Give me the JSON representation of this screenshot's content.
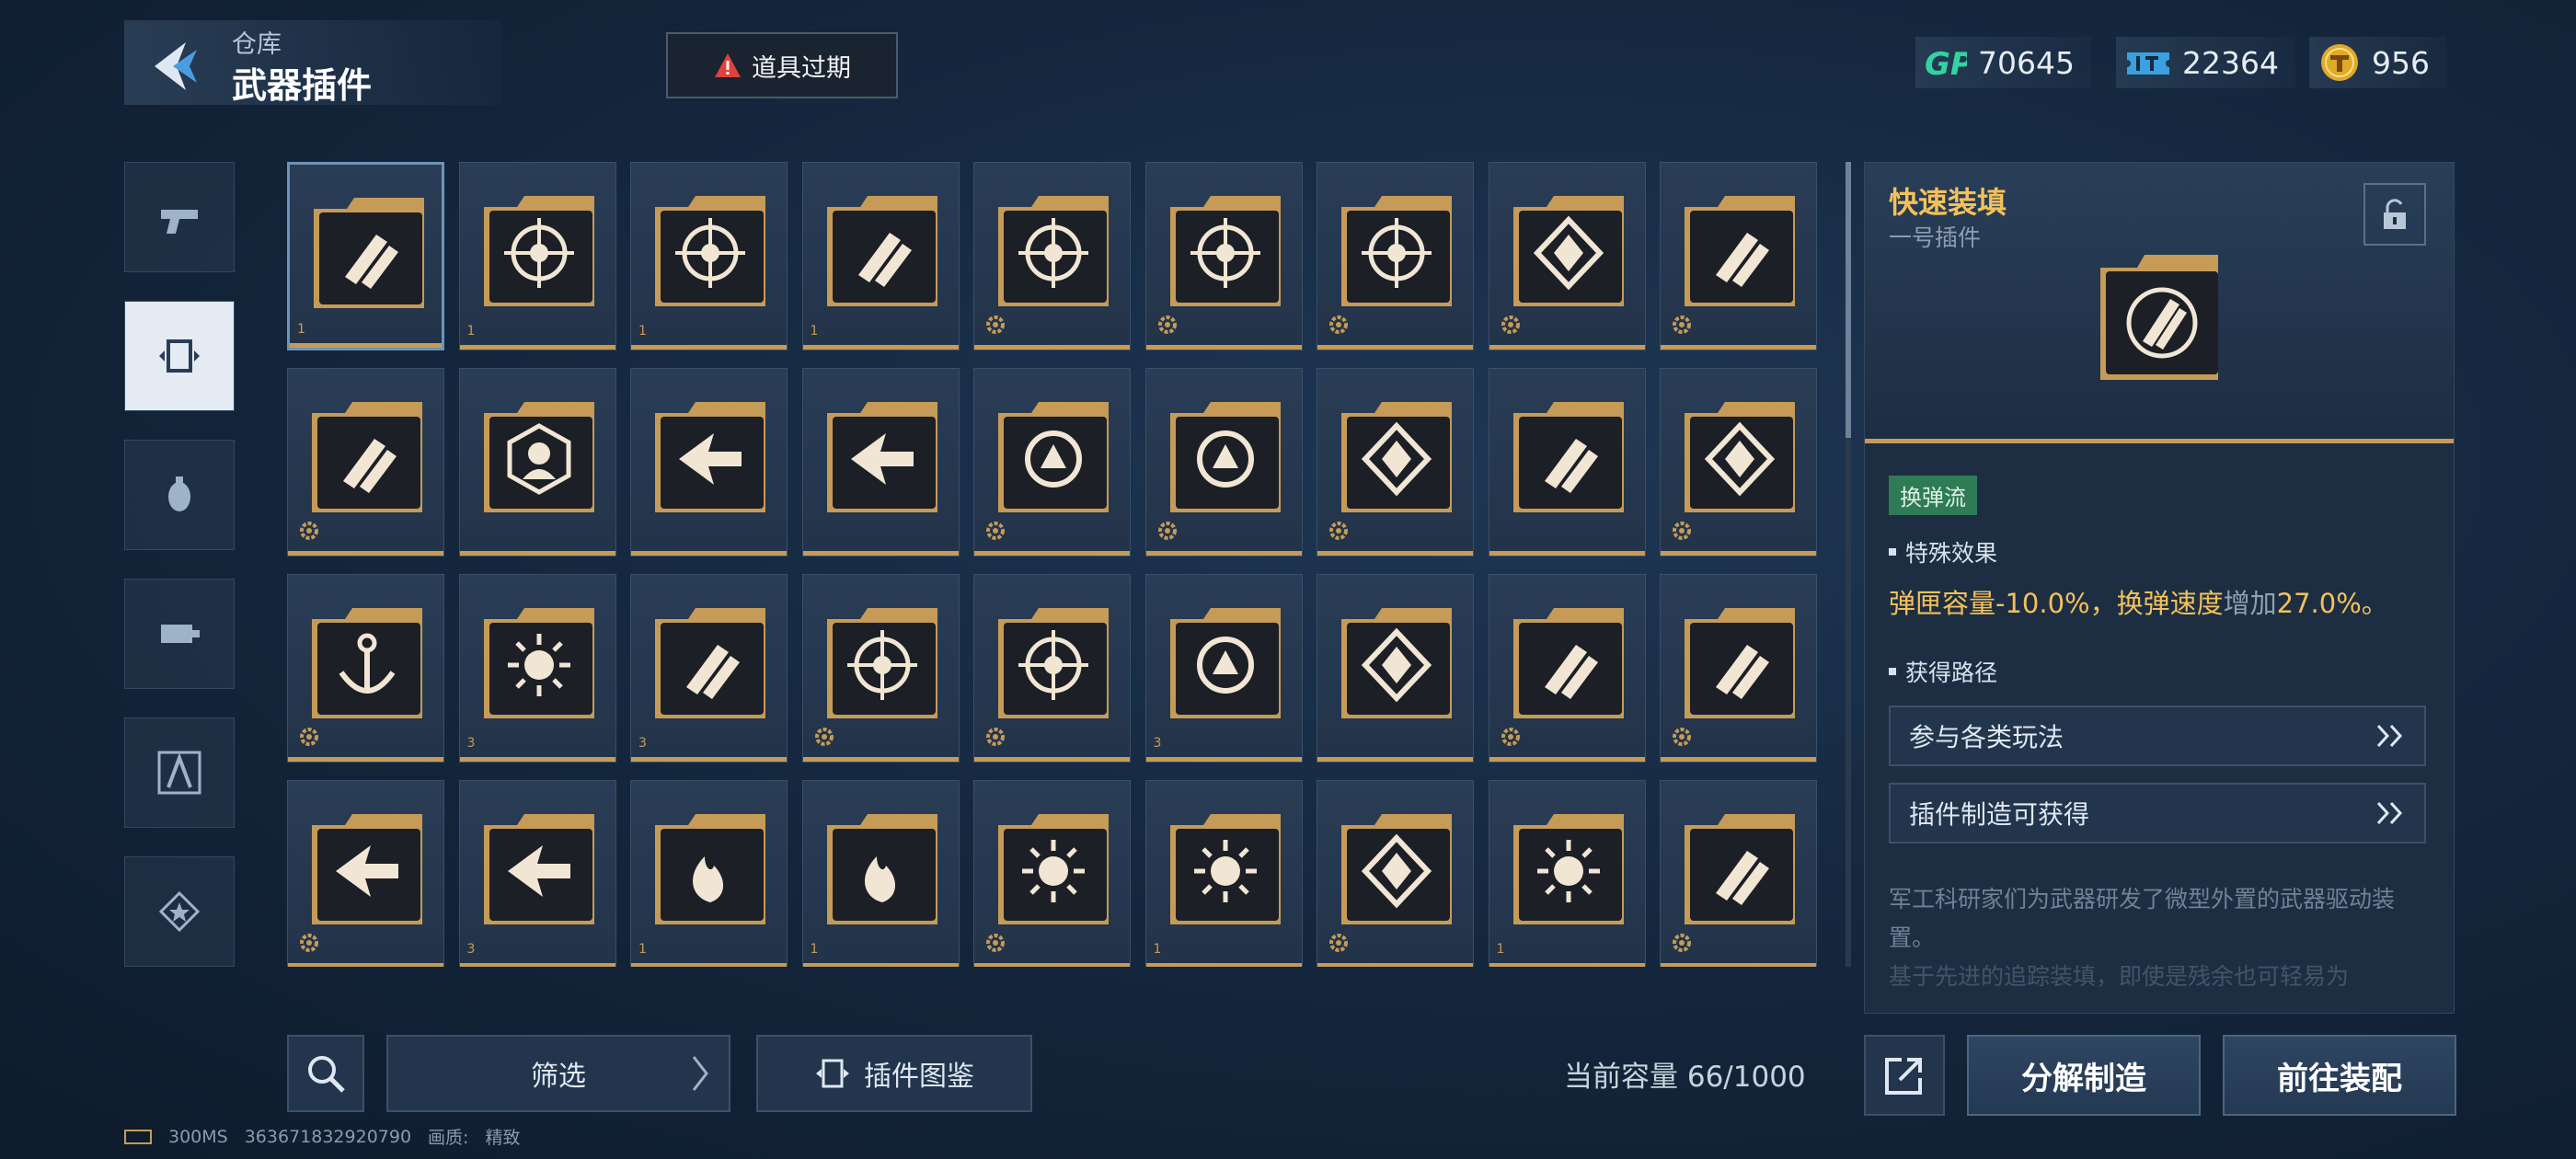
{
  "header": {
    "breadcrumb_parent": "仓库",
    "page_title": "武器插件",
    "expire_button": "道具过期"
  },
  "currencies": [
    {
      "icon": "gp-currency-icon",
      "value": "70645"
    },
    {
      "icon": "ticket-currency-icon",
      "value": "22364"
    },
    {
      "icon": "gold-coin-icon",
      "value": "956"
    }
  ],
  "category_tabs": [
    {
      "icon": "pistol-icon",
      "active": false
    },
    {
      "icon": "plugin-chip-icon",
      "active": true
    },
    {
      "icon": "grenade-icon",
      "active": false
    },
    {
      "icon": "tactical-gear-icon",
      "active": false
    },
    {
      "icon": "compass-tool-icon",
      "active": false
    },
    {
      "icon": "star-badge-icon",
      "active": false
    }
  ],
  "grid": {
    "columns": 9,
    "rows": 4,
    "items": [
      {
        "icon": "rocket-reload-icon",
        "num": "1",
        "gear": false
      },
      {
        "icon": "soldier-target-icon",
        "num": "1",
        "gear": false
      },
      {
        "icon": "soldier-target-icon",
        "num": "1",
        "gear": false
      },
      {
        "icon": "twin-bullet-icon",
        "num": "1",
        "gear": false
      },
      {
        "icon": "arrow-up-target-icon",
        "num": "",
        "gear": true
      },
      {
        "icon": "arrow-up-target-icon",
        "num": "",
        "gear": true
      },
      {
        "icon": "arrow-up-target-icon",
        "num": "",
        "gear": true
      },
      {
        "icon": "diamond-sigil-icon",
        "num": "",
        "gear": true
      },
      {
        "icon": "speed-bullet-icon",
        "num": "",
        "gear": true
      },
      {
        "icon": "speed-bullet-icon",
        "num": "",
        "gear": true
      },
      {
        "icon": "hexagon-soldier-icon",
        "num": "",
        "gear": false
      },
      {
        "icon": "wing-arrow-icon",
        "num": "",
        "gear": false
      },
      {
        "icon": "wing-arrow-icon",
        "num": "",
        "gear": false
      },
      {
        "icon": "cycle-triangle-icon",
        "num": "",
        "gear": true
      },
      {
        "icon": "cycle-triangle-icon",
        "num": "",
        "gear": true
      },
      {
        "icon": "sword-down-icon",
        "num": "",
        "gear": true
      },
      {
        "icon": "missile-up-icon",
        "num": "",
        "gear": false
      },
      {
        "icon": "shield-swap-icon",
        "num": "",
        "gear": true
      },
      {
        "icon": "anchor-icon",
        "num": "",
        "gear": true
      },
      {
        "icon": "comet-icon",
        "num": "3",
        "gear": false
      },
      {
        "icon": "crossed-bullets-icon",
        "num": "3",
        "gear": false
      },
      {
        "icon": "crosshair-icon",
        "num": "",
        "gear": true
      },
      {
        "icon": "crosshair-icon",
        "num": "",
        "gear": true
      },
      {
        "icon": "hand-reload-icon",
        "num": "3",
        "gear": false
      },
      {
        "icon": "split-shield-icon",
        "num": "",
        "gear": false
      },
      {
        "icon": "ammo-row-icon",
        "num": "",
        "gear": true
      },
      {
        "icon": "ammo-row-icon",
        "num": "",
        "gear": true
      },
      {
        "icon": "arrow-left-icon",
        "num": "",
        "gear": true
      },
      {
        "icon": "chevron-burst-icon",
        "num": "3",
        "gear": false
      },
      {
        "icon": "flame-icon",
        "num": "1",
        "gear": false
      },
      {
        "icon": "flame-icon",
        "num": "1",
        "gear": false
      },
      {
        "icon": "explosion-cloud-icon",
        "num": "",
        "gear": true
      },
      {
        "icon": "sun-burst-icon",
        "num": "1",
        "gear": false
      },
      {
        "icon": "claw-icon",
        "num": "",
        "gear": true
      },
      {
        "icon": "ground-blast-icon",
        "num": "1",
        "gear": false
      },
      {
        "icon": "shell-up-icon",
        "num": "",
        "gear": true
      }
    ]
  },
  "detail": {
    "title": "快速装填",
    "subtitle": "一号插件",
    "tag": "换弹流",
    "section_effect": "特殊效果",
    "effect_text_a": "弹匣容量",
    "effect_text_b": "-10.0%，",
    "effect_text_c": "换弹速度",
    "effect_text_d": "增加",
    "effect_text_e": "27.0%。",
    "section_source": "获得路径",
    "routes": [
      "参与各类玩法",
      "插件制造可获得"
    ],
    "description": "军工科研家们为武器研发了微型外置的武器驱动装置。",
    "description_faded": "基于先进的追踪装填，即使是残余也可轻易为"
  },
  "bottom": {
    "filter_label": "筛选",
    "codex_label": "插件图鉴",
    "capacity": "当前容量 66/1000",
    "dismantle_label": "分解制造",
    "equip_label": "前往装配"
  },
  "status": {
    "ping": "300MS",
    "uid": "363671832920790",
    "quality_label": "画质:",
    "quality_value": "精致"
  },
  "colors": {
    "gold": "#c59b57",
    "title_gold": "#f4c15a",
    "tag_green": "#2e7b56",
    "panel": "#1d2e43"
  }
}
